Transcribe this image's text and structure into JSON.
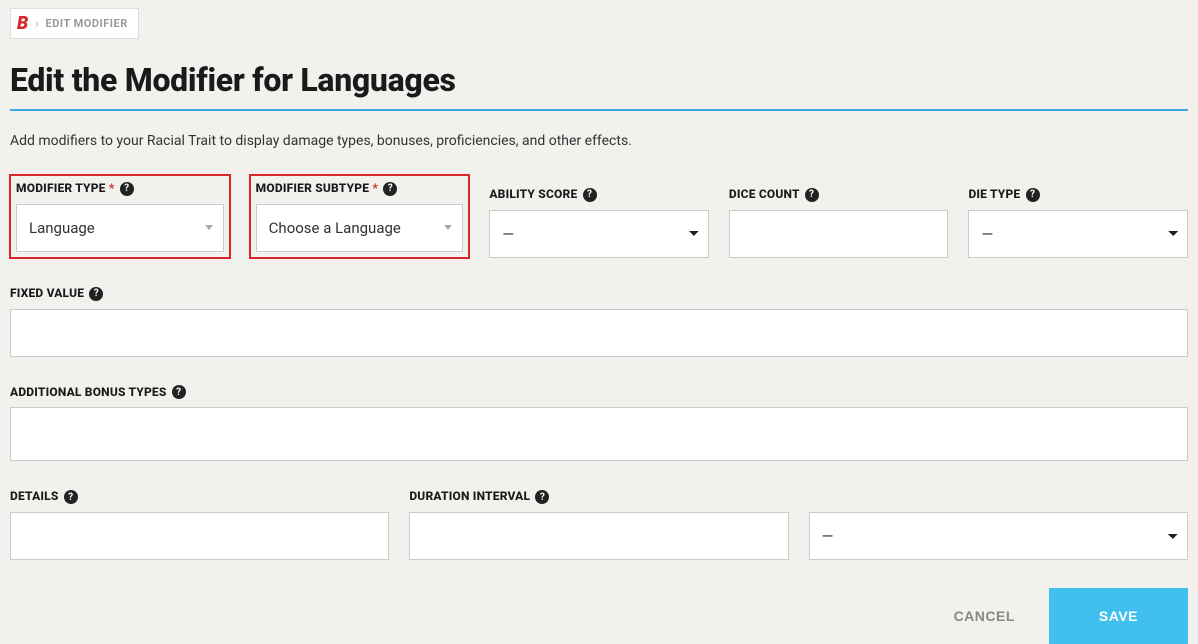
{
  "breadcrumb": {
    "logo": "B",
    "current": "EDIT MODIFIER"
  },
  "page_title": "Edit the Modifier for Languages",
  "description": "Add modifiers to your Racial Trait to display damage types, bonuses, proficiencies, and other effects.",
  "fields": {
    "modifier_type": {
      "label": "MODIFIER TYPE",
      "value": "Language",
      "required": true
    },
    "modifier_subtype": {
      "label": "MODIFIER SUBTYPE",
      "value": "Choose a Language",
      "required": true
    },
    "ability_score": {
      "label": "ABILITY SCORE",
      "value": "—"
    },
    "dice_count": {
      "label": "DICE COUNT",
      "value": ""
    },
    "die_type": {
      "label": "DIE TYPE",
      "value": "—"
    },
    "fixed_value": {
      "label": "FIXED VALUE",
      "value": ""
    },
    "additional_bonus_types": {
      "label": "ADDITIONAL BONUS TYPES",
      "value": ""
    },
    "details": {
      "label": "DETAILS",
      "value": ""
    },
    "duration_interval": {
      "label": "DURATION INTERVAL",
      "value": ""
    },
    "duration_unit": {
      "value": "—"
    }
  },
  "buttons": {
    "cancel": "CANCEL",
    "save": "SAVE"
  }
}
